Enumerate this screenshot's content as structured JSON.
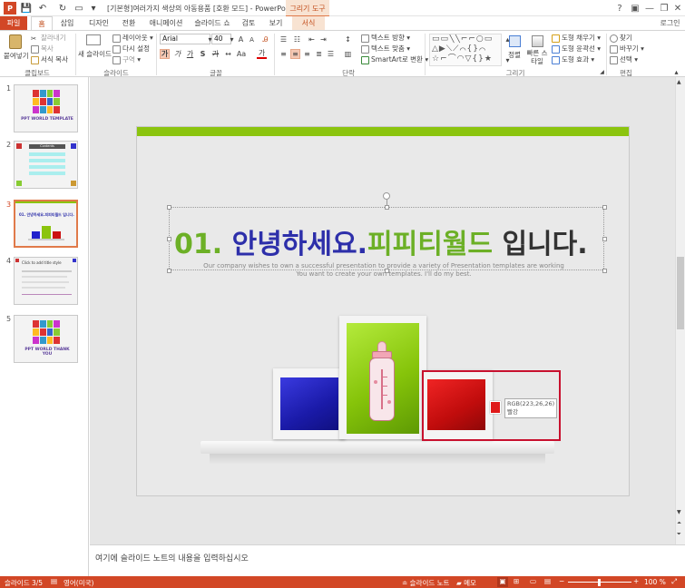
{
  "window": {
    "title": "[기본형]여러가지 색상의 아동용품 [호환 모드] - PowerPoint",
    "context_tab_group": "그리기 도구",
    "help": "?",
    "login": "로그인"
  },
  "tabs": [
    "파일",
    "홈",
    "삽입",
    "디자인",
    "전환",
    "애니메이션",
    "슬라이드 쇼",
    "검토",
    "보기",
    "서식"
  ],
  "ribbon": {
    "clipboard": {
      "paste": "붙여넣기",
      "cut": "잘라내기",
      "copy": "복사",
      "format_painter": "서식 복사",
      "label": "클립보드"
    },
    "slides": {
      "new_slide": "새 슬라이드",
      "layout": "레이아웃",
      "reset": "다시 설정",
      "section": "구역",
      "label": "슬라이드"
    },
    "font": {
      "name": "Arial",
      "size": "40",
      "label": "글꼴"
    },
    "paragraph": {
      "text_direction": "텍스트 방향",
      "align_text": "텍스트 맞춤",
      "smartart": "SmartArt로 변환",
      "label": "단락"
    },
    "drawing": {
      "arrange": "정렬",
      "quick_styles": "빠른 스타일",
      "shape_fill": "도형 채우기",
      "shape_outline": "도형 윤곽선",
      "shape_effects": "도형 효과",
      "label": "그리기"
    },
    "editing": {
      "find": "찾기",
      "replace": "바꾸기",
      "select": "선택",
      "label": "편집"
    }
  },
  "thumbnails": [
    {
      "num": "1",
      "caption": "PPT WORLD TEMPLATE"
    },
    {
      "num": "2",
      "caption": "Contents"
    },
    {
      "num": "3",
      "caption": "01. 안녕하세요.피피티월드 입니다."
    },
    {
      "num": "4",
      "caption": "Click to add title style"
    },
    {
      "num": "5",
      "caption": "PPT WORLD THANK YOU"
    }
  ],
  "slide": {
    "title_num": "01.",
    "title_part1": " 안녕하세요",
    "title_dot": ".",
    "title_part2": "피피티월드",
    "title_part3": " 입니다.",
    "subtitle_line1": "Our company wishes to own a successful presentation to provide a variety of Presentation  templates are working",
    "subtitle_line2": "You want to create your own templates. I'll do my best.",
    "tooltip_rgb": "RGB(223,26,26)",
    "tooltip_name": "빨강"
  },
  "notes": "여기에 슬라이드 노트의 내용을 입력하십시오",
  "status": {
    "slide": "슬라이드 3/5",
    "language": "영어(미국)",
    "notes": "슬라이드 노트",
    "comments": "메모",
    "zoom": "100 %"
  },
  "colors": {
    "accent": "#d24726",
    "green": "#8bc40e",
    "blue_title": "#2d2faa",
    "red_box": "#c8102e"
  }
}
